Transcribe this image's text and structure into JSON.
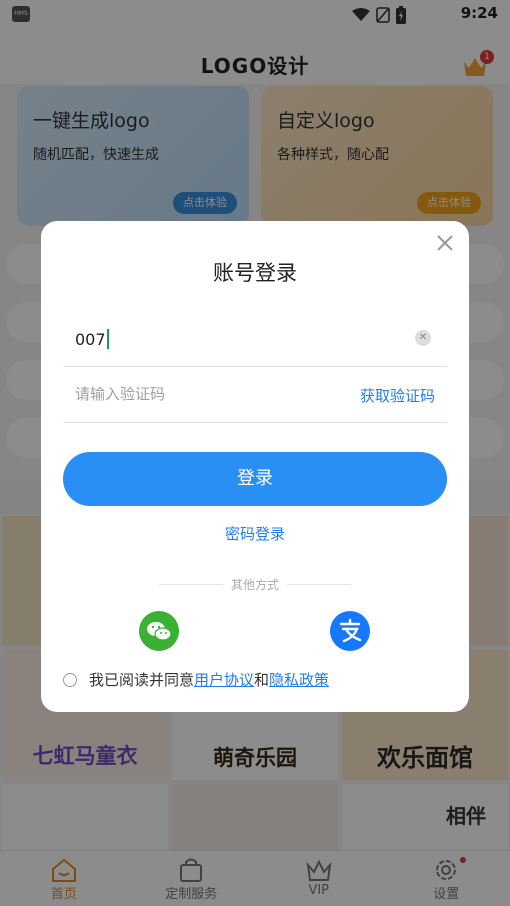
{
  "statusbar": {
    "hms": "HMS",
    "time": "9:24"
  },
  "header": {
    "title": "LOGO设计",
    "crown_badge": "1"
  },
  "cards": [
    {
      "title": "一键生成logo",
      "subtitle": "随机匹配，快速生成",
      "button": "点击体验"
    },
    {
      "title": "自定义logo",
      "subtitle": "各种样式，随心配",
      "button": "点击体验"
    }
  ],
  "thumbs": [
    {
      "text": "七虹马童衣",
      "color": "#6b4ec7"
    },
    {
      "text": "萌奇乐园",
      "color": "#3a2a1a"
    },
    {
      "text": "欢乐面馆",
      "color": "#2a2a2a"
    },
    {
      "text": "相伴",
      "color": "#333333"
    }
  ],
  "tabs": [
    {
      "label": "首页",
      "icon": "home-icon",
      "active": true
    },
    {
      "label": "定制服务",
      "icon": "bag-icon",
      "active": false
    },
    {
      "label": "VIP",
      "icon": "crown-icon",
      "active": false
    },
    {
      "label": "设置",
      "icon": "gear-icon",
      "active": false
    }
  ],
  "dialog": {
    "title": "账号登录",
    "phone_value": "007",
    "code_placeholder": "请输入验证码",
    "get_code": "获取验证码",
    "login_button": "登录",
    "password_login": "密码登录",
    "other_methods": "其他方式",
    "social": [
      "wechat-icon",
      "alipay-icon"
    ],
    "agreement": {
      "prefix": "我已阅读并同意",
      "user_agreement": "用户协议",
      "and": "和",
      "privacy_policy": "隐私政策"
    }
  },
  "colors": {
    "primary": "#2a8ff5",
    "accent_tab": "#e0882a",
    "link": "#1f7fe8"
  }
}
